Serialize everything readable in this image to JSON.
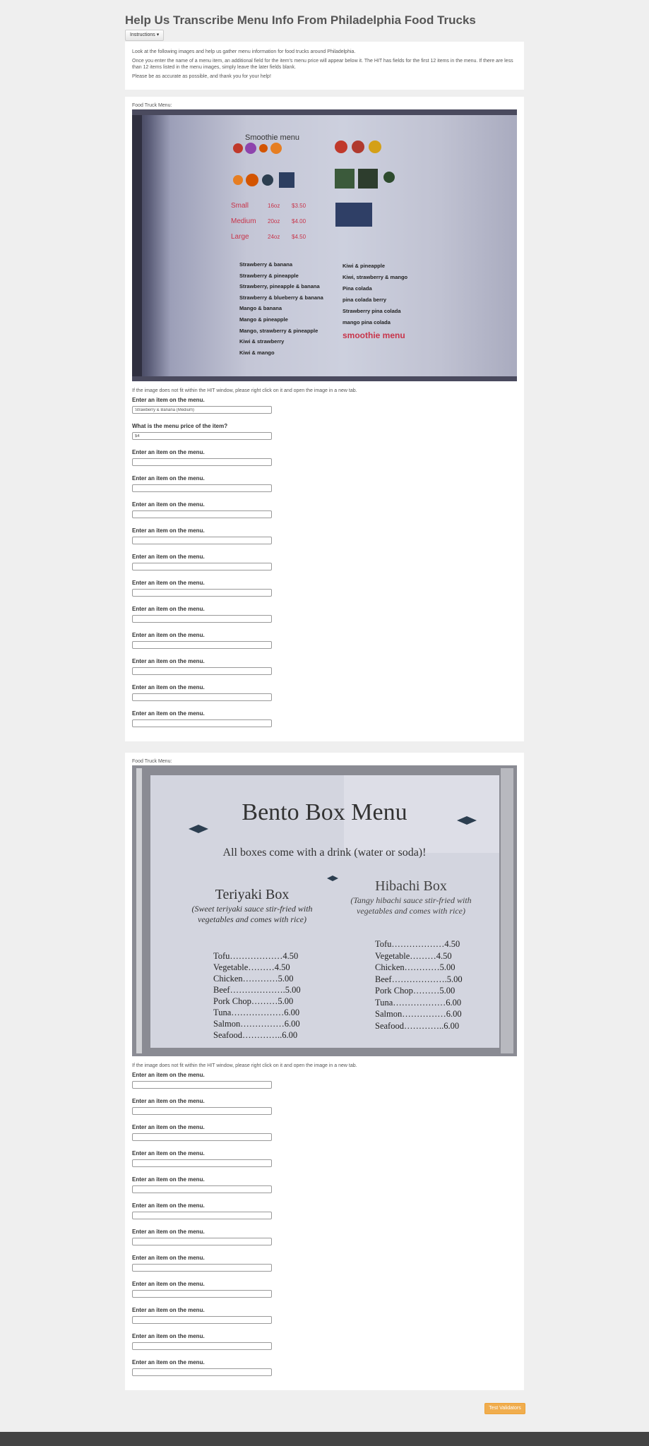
{
  "page": {
    "title": "Help Us Transcribe Menu Info From Philadelphia Food Trucks",
    "instructions_button": "Instructions ▾",
    "intro": [
      "Look at the following images and help us gather menu information for food trucks around Philadelphia.",
      "Once you enter the name of a menu item, an additional field for the item's menu price will appear below it. The HIT has fields for the first 12 items in the menu. If there are less than 12 items listed in the menu images, simply leave the later fields blank.",
      "Please be as accurate as possible, and thank you for your help!"
    ],
    "submit_label": "Test Validators"
  },
  "section1": {
    "label": "Food Truck Menu:",
    "note": "If the image does not fit within the HIT window, please right click on it and open the image in a new tab.",
    "item_label": "Enter an item on the menu.",
    "price_label": "What is the menu price of the item?",
    "item1_value": "Strawberry & Banana (Medium)",
    "price1_value": "$4",
    "menu": {
      "title": "Smoothie menu",
      "sizes": [
        {
          "name": "Small",
          "oz": "16oz",
          "price": "$3.50"
        },
        {
          "name": "Medium",
          "oz": "20oz",
          "price": "$4.00"
        },
        {
          "name": "Large",
          "oz": "24oz",
          "price": "$4.50"
        }
      ],
      "left_items": [
        "Strawberry & banana",
        "Strawberry & pineapple",
        "Strawberry, pineapple & banana",
        "Strawberry & blueberry & banana",
        "Mango & banana",
        "Mango & pineapple",
        "Mango, strawberry & pineapple",
        "Kiwi & strawberry",
        "Kiwi & mango"
      ],
      "right_items": [
        "Kiwi & pineapple",
        "Kiwi, strawberry & mango",
        "Pina colada",
        "pina colada berry",
        "Strawberry pina colada",
        "mango pina colada"
      ],
      "footer": "smoothie menu"
    }
  },
  "section2": {
    "label": "Food Truck Menu:",
    "note": "If the image does not fit within the HIT window, please right click on it and open the image in a new tab.",
    "item_label": "Enter an item on the menu.",
    "menu": {
      "title": "Bento Box Menu",
      "subtitle": "All boxes come with a drink (water or soda)!",
      "left_title": "Teriyaki Box",
      "left_desc": "(Sweet teriyaki sauce stir-fried with vegetables and comes with rice)",
      "left_items": [
        "Tofu………………4.50",
        "Vegetable………4.50",
        "Chicken…………5.00",
        "Beef……………….5.00",
        "Pork Chop………5.00",
        "Tuna………………6.00",
        "Salmon……………6.00",
        "Seafood…………..6.00"
      ],
      "right_title": "Hibachi Box",
      "right_desc": "(Tangy hibachi sauce stir-fried with vegetables and comes with rice)",
      "right_items": [
        "Tofu………………4.50",
        "Vegetable………4.50",
        "Chicken…………5.00",
        "Beef……………….5.00",
        "Pork Chop………5.00",
        "Tuna………………6.00",
        "Salmon……………6.00",
        "Seafood…………..6.00"
      ]
    }
  },
  "colors": {
    "accent": "#f0ad4e",
    "background": "#efefef",
    "menu_red": "#c8344a"
  }
}
